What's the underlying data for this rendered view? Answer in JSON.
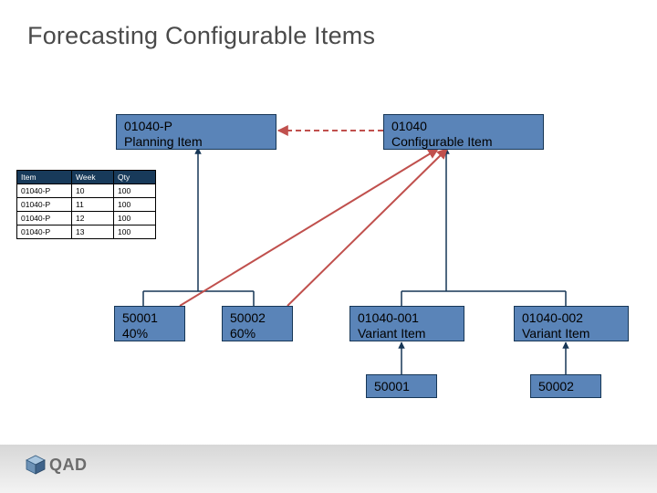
{
  "title": "Forecasting Configurable Items",
  "boxes": {
    "planning": {
      "line1": "01040-P",
      "line2": "Planning Item"
    },
    "configurable": {
      "line1": "01040",
      "line2": "Configurable Item"
    },
    "planBom1": {
      "line1": "50001",
      "line2": "40%"
    },
    "planBom2": {
      "line1": "50002",
      "line2": "60%"
    },
    "variant1": {
      "line1": "01040-001",
      "line2": "Variant Item"
    },
    "variant2": {
      "line1": "01040-002",
      "line2": "Variant Item"
    },
    "comp1": {
      "line1": "50001"
    },
    "comp2": {
      "line1": "50002"
    }
  },
  "table": {
    "headers": [
      "Item",
      "Week",
      "Qty"
    ],
    "rows": [
      [
        "01040-P",
        "10",
        "100"
      ],
      [
        "01040-P",
        "11",
        "100"
      ],
      [
        "01040-P",
        "12",
        "100"
      ],
      [
        "01040-P",
        "13",
        "100"
      ]
    ]
  },
  "footer": {
    "logo_text": "QAD"
  },
  "colors": {
    "box_fill": "#5a84b8",
    "box_border": "#163656",
    "header_fill": "#183a5a"
  }
}
